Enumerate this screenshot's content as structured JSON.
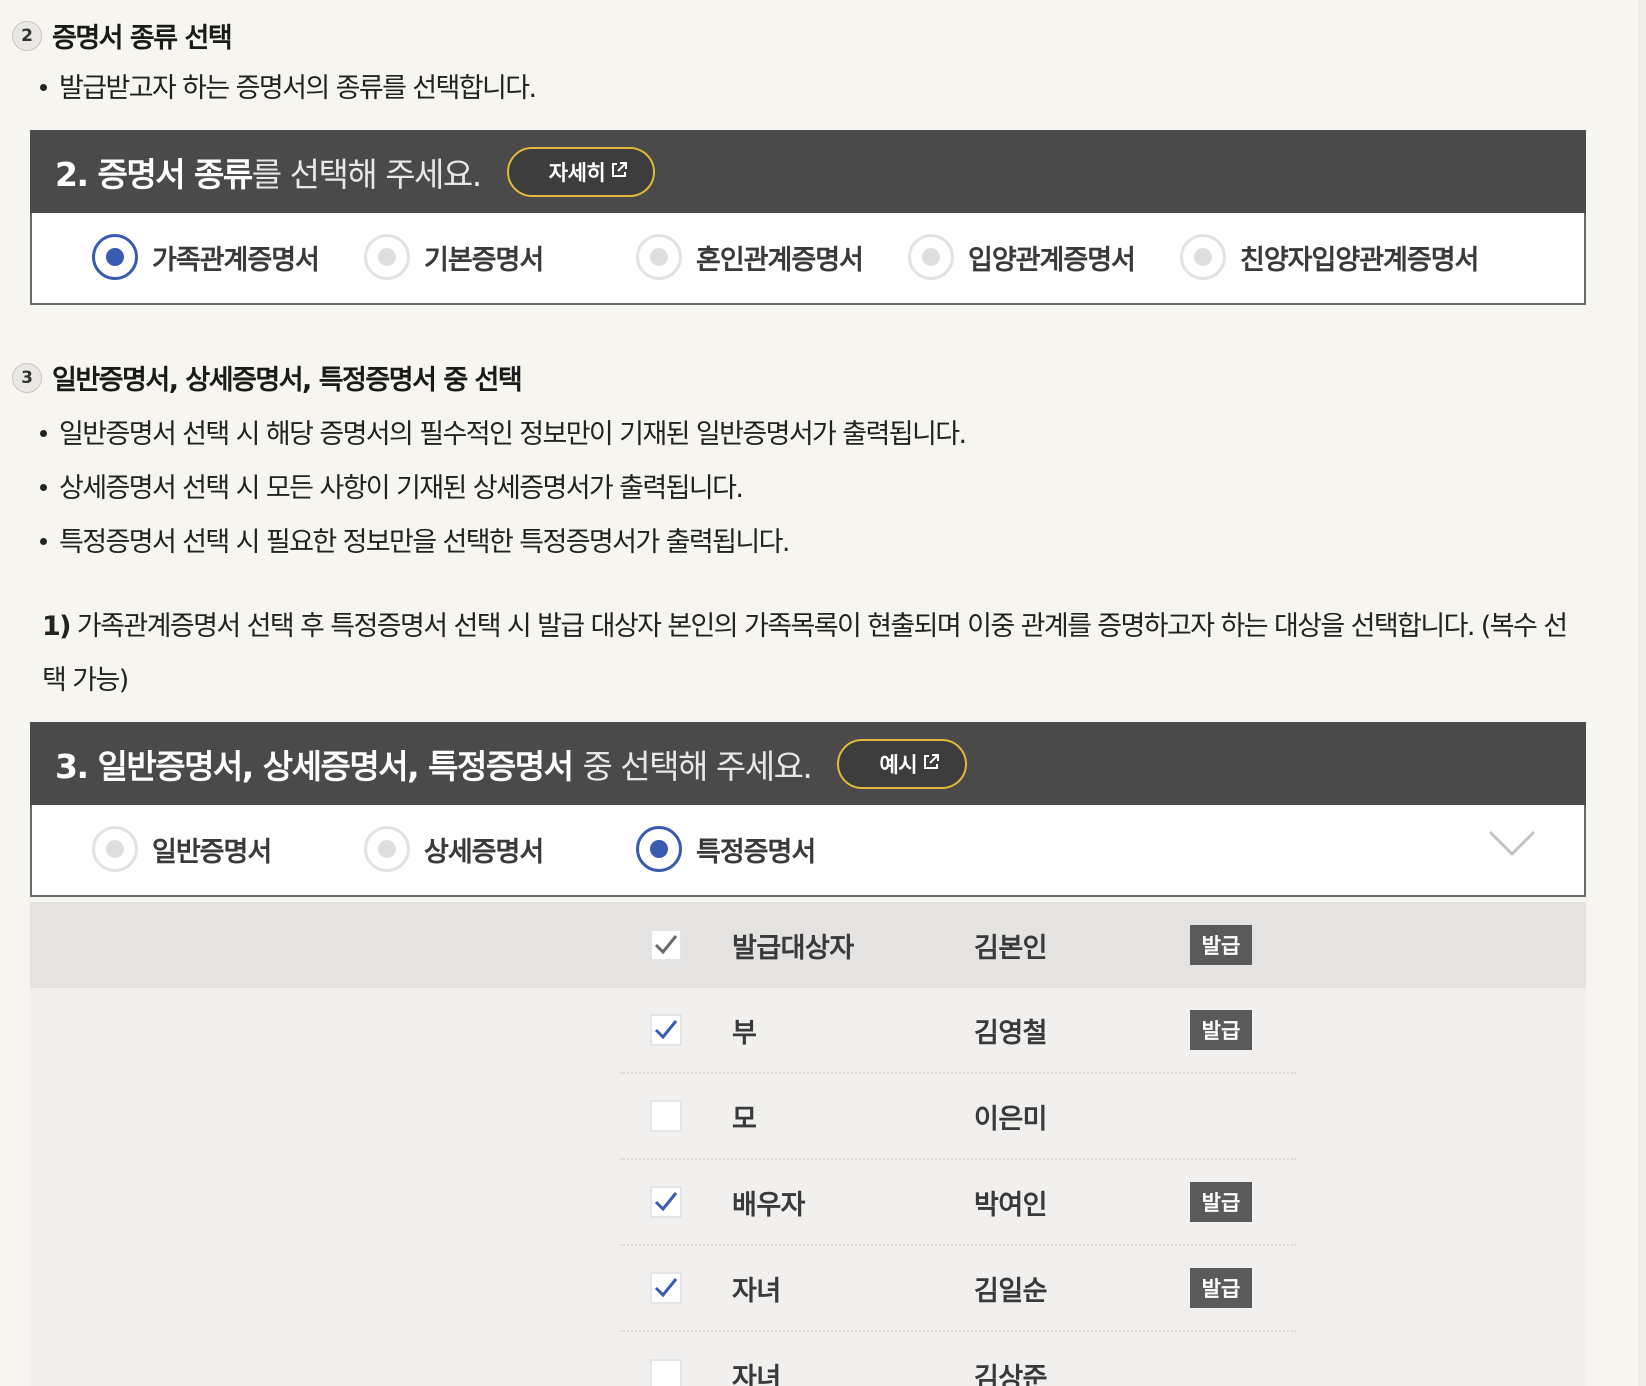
{
  "section2": {
    "num": "2",
    "title": "증명서 종류 선택",
    "bullet": "발급받고자 하는 증명서의 종류를 선택합니다.",
    "panel": {
      "title_strong_1": "2. 증명서 종류",
      "title_rest": "를 선택해 주세요.",
      "button": "자세히",
      "options": [
        "가족관계증명서",
        "기본증명서",
        "혼인관계증명서",
        "입양관계증명서",
        "친양자입양관계증명서"
      ],
      "selected": "가족관계증명서"
    }
  },
  "section3": {
    "num": "3",
    "title": "일반증명서, 상세증명서, 특정증명서 중 선택",
    "bullets": [
      "일반증명서 선택 시 해당 증명서의 필수적인 정보만이 기재된 일반증명서가 출력됩니다.",
      "상세증명서 선택 시 모든 사항이 기재된 상세증명서가 출력됩니다.",
      "특정증명서 선택 시 필요한 정보만을 선택한 특정증명서가 출력됩니다."
    ],
    "note_num": "1)",
    "note": "가족관계증명서 선택 후 특정증명서 선택 시 발급 대상자 본인의 가족목록이 현출되며 이중 관계를 증명하고자 하는 대상을 선택합니다. (복수 선택 가능)",
    "panel": {
      "title_strong": "3. 일반증명서, 상세증명서, 특정증명서",
      "title_rest": "중 선택해 주세요.",
      "button": "예시",
      "options": [
        "일반증명서",
        "상세증명서",
        "특정증명서"
      ],
      "selected": "특정증명서"
    },
    "family": [
      {
        "relation": "발급대상자",
        "name": "김본인",
        "checked": true,
        "badge": "발급"
      },
      {
        "relation": "부",
        "name": "김영철",
        "checked": true,
        "badge": "발급"
      },
      {
        "relation": "모",
        "name": "이은미",
        "checked": false,
        "badge": ""
      },
      {
        "relation": "배우자",
        "name": "박여인",
        "checked": true,
        "badge": "발급"
      },
      {
        "relation": "자녀",
        "name": "김일순",
        "checked": true,
        "badge": "발급"
      },
      {
        "relation": "자녀",
        "name": "김상준",
        "checked": false,
        "badge": ""
      }
    ]
  },
  "colors": {
    "header_bg": "#4a4a4a",
    "accent_blue": "#3a5cb0",
    "button_border": "#e3b93a",
    "badge_bg": "#5a5a5a",
    "page_bg": "#f7f5ef"
  },
  "icons": {
    "external_link": "external-link-icon",
    "chevron": "chevron-down-icon",
    "checkbox": "checkbox-icon"
  }
}
